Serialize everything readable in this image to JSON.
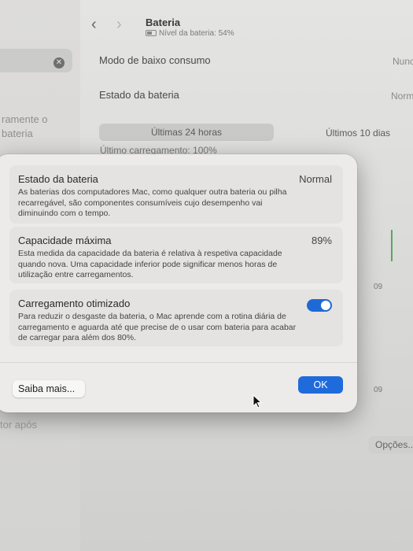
{
  "background": {
    "title": "Bateria",
    "subtitle": "Nível da bateria: 54%",
    "rows": [
      {
        "label": "Modo de baixo consumo",
        "value": "Nunc"
      },
      {
        "label": "Estado da bateria",
        "value": "Norm"
      }
    ],
    "sidebar_texts": [
      "ramente o",
      "bateria",
      "tor após"
    ],
    "segments": [
      "Últimas 24 horas",
      "Últimos 10 dias"
    ],
    "partial_text": "Último carregamento: 100%",
    "tick_labels": [
      "09",
      "09"
    ],
    "options_button": "Opções..."
  },
  "dialog": {
    "sections": [
      {
        "title": "Estado da bateria",
        "value": "Normal",
        "description": "As baterias dos computadores Mac, como qualquer outra bateria ou pilha recarregável, são componentes consumíveis cujo desempenho vai diminuindo com o tempo."
      },
      {
        "title": "Capacidade máxima",
        "value": "89%",
        "description": "Esta medida da capacidade da bateria é relativa à respetiva capacidade quando nova. Uma capacidade inferior pode significar menos horas de utilização entre carregamentos."
      },
      {
        "title": "Carregamento otimizado",
        "toggle_on": true,
        "description": "Para reduzir o desgaste da bateria, o Mac aprende com a rotina diária de carregamento e aguarda até que precise de o usar com bateria para acabar de carregar para além dos 80%."
      }
    ],
    "learn_more_label": "Saiba mais...",
    "ok_label": "OK"
  },
  "colors": {
    "accent": "#1f6bdb",
    "chart_bar": "#57a85a"
  }
}
